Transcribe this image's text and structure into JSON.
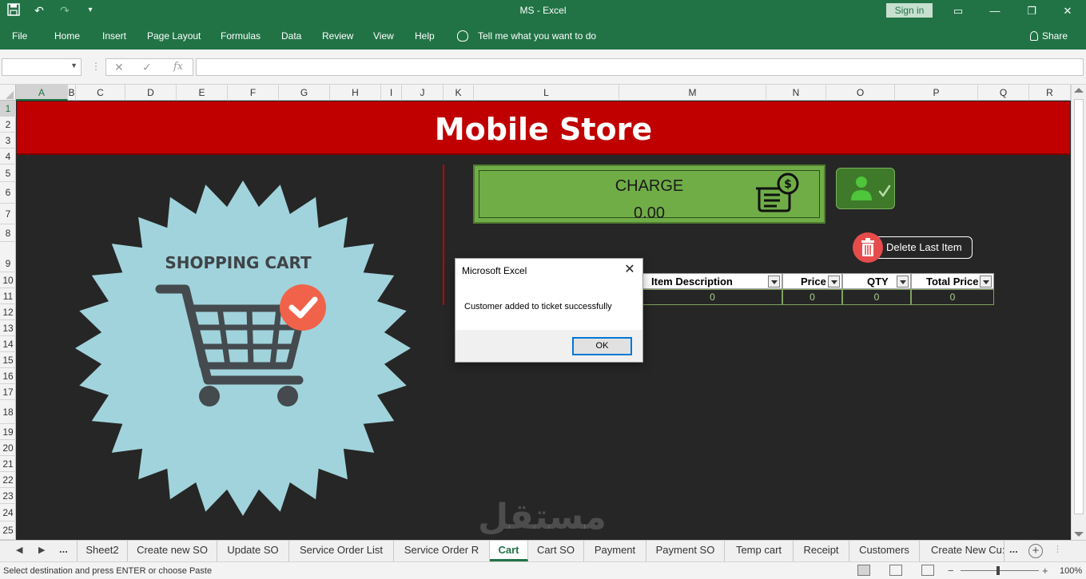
{
  "window": {
    "title": "MS  -  Excel",
    "sign_in": "Sign in",
    "colors": {
      "excel_green": "#217346",
      "banner_red": "#c00000",
      "charge_green": "#70ad47"
    }
  },
  "ribbon": {
    "tabs": [
      "File",
      "Home",
      "Insert",
      "Page Layout",
      "Formulas",
      "Data",
      "Review",
      "View",
      "Help"
    ],
    "tell_me": "Tell me what you want to do",
    "share": "Share"
  },
  "formula_bar": {
    "name_box": "",
    "formula": "",
    "fx_label": "fx"
  },
  "columns": [
    "A",
    "B",
    "C",
    "D",
    "E",
    "F",
    "G",
    "H",
    "I",
    "J",
    "K",
    "L",
    "M",
    "N",
    "O",
    "P",
    "Q",
    "R"
  ],
  "rows": [
    "1",
    "2",
    "3",
    "4",
    "5",
    "6",
    "7",
    "8",
    "9",
    "10",
    "11",
    "12",
    "13",
    "14",
    "15",
    "16",
    "17",
    "18",
    "19",
    "20",
    "21",
    "22",
    "23",
    "24",
    "25"
  ],
  "sheet": {
    "banner_title": "Mobile Store",
    "badge_title": "SHOPPING CART",
    "charge": {
      "label": "CHARGE",
      "amount": "0.00"
    },
    "delete_button": "Delete Last Item",
    "table": {
      "headers": [
        "Item Description",
        "Price",
        "QTY",
        "Total Price"
      ],
      "row": [
        "0",
        "0",
        "0",
        "0"
      ]
    }
  },
  "dialog": {
    "title": "Microsoft Excel",
    "message": "Customer added to ticket successfully",
    "ok": "OK"
  },
  "sheet_tabs": {
    "more": "...",
    "tabs": [
      "Sheet2",
      "Create new SO",
      "Update SO",
      "Service Order List",
      "Service Order R",
      "Cart",
      "Cart SO",
      "Payment",
      "Payment SO",
      "Temp cart",
      "Receipt",
      "Customers",
      "Create New Cu:"
    ],
    "active": "Cart",
    "more_right": "..."
  },
  "status": {
    "message": "Select destination and press ENTER or choose Paste",
    "zoom": "100%"
  },
  "watermark": "مستقل"
}
